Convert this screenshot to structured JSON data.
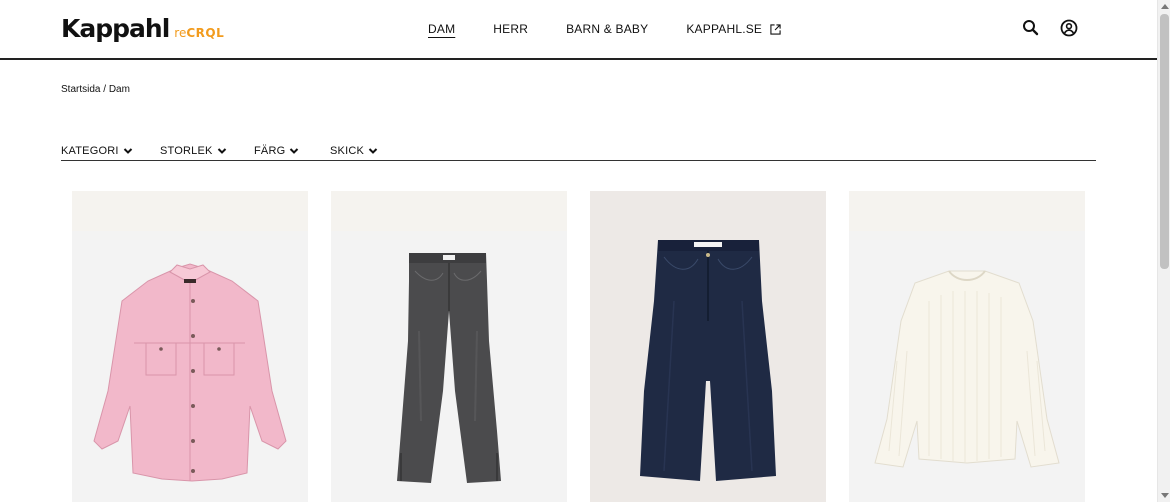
{
  "brand": {
    "name": "Kappahl",
    "sub_prefix": "re",
    "sub_main": "CRQL",
    "accent": "#f29b1d"
  },
  "nav": {
    "items": [
      {
        "label": "DAM",
        "active": true
      },
      {
        "label": "HERR",
        "active": false
      },
      {
        "label": "BARN & BABY",
        "active": false
      },
      {
        "label": "KAPPAHL.SE",
        "active": false,
        "external": true
      }
    ]
  },
  "header_icons": [
    "search-icon",
    "account-icon"
  ],
  "breadcrumb": {
    "home": "Startsida",
    "separator": " / ",
    "current": "Dam"
  },
  "filters": [
    {
      "label": "KATEGORI"
    },
    {
      "label": "STORLEK"
    },
    {
      "label": "FÄRG"
    },
    {
      "label": "SKICK"
    }
  ],
  "products": [
    {
      "item": "pink-shirt-jacket",
      "color": "#f2b7c9"
    },
    {
      "item": "grey-flare-jeans",
      "color": "#4a4a4a"
    },
    {
      "item": "dark-wide-jeans",
      "color": "#1f2a44"
    },
    {
      "item": "white-knit-sweater",
      "color": "#f6f3ea"
    }
  ]
}
